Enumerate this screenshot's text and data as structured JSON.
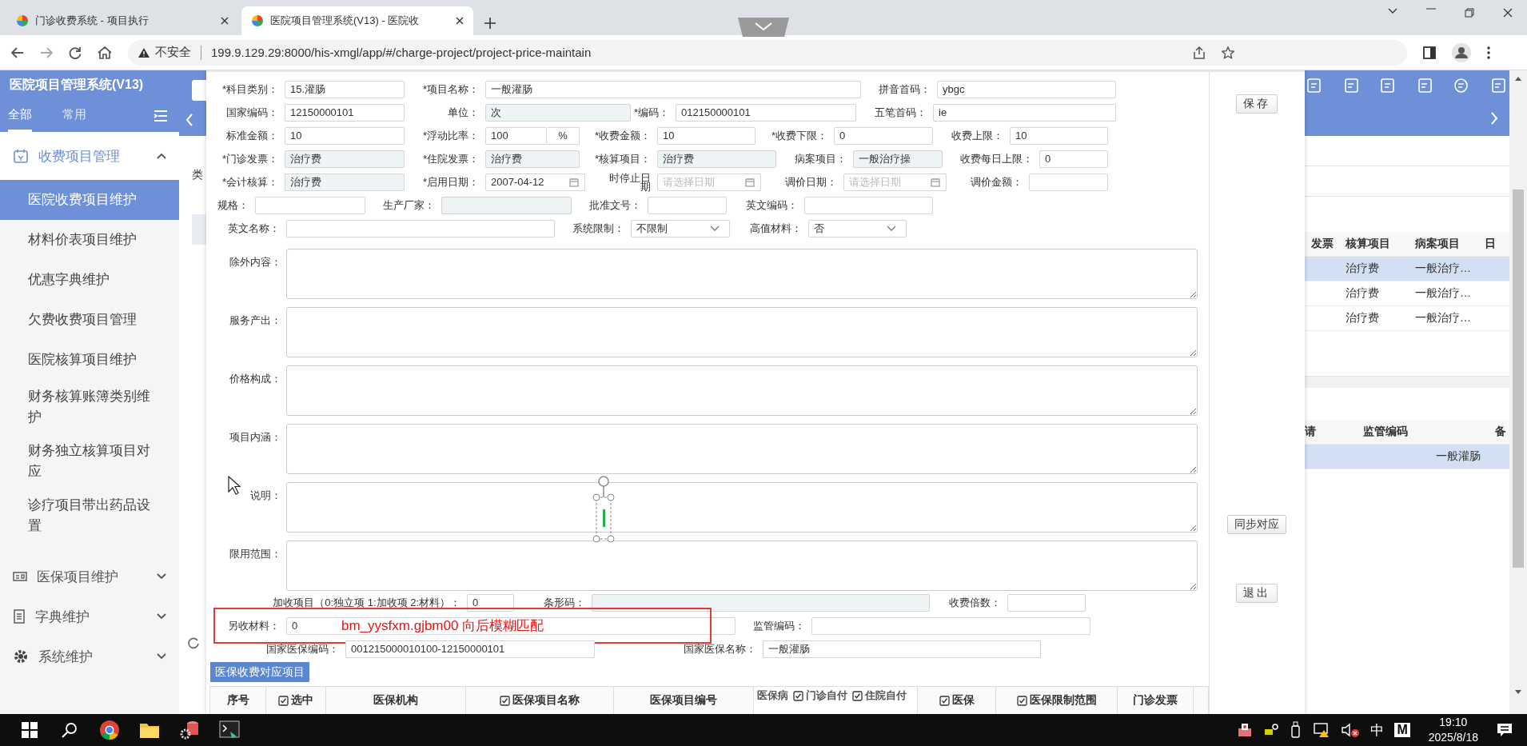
{
  "browser": {
    "tabs": [
      {
        "title": "门诊收费系统 - 项目执行",
        "selected": false
      },
      {
        "title": "医院项目管理系统(V13) - 医院收",
        "selected": true
      }
    ],
    "security": "不安全",
    "url": "199.9.129.29:8000/his-xmgl/app/#/charge-project/project-price-maintain"
  },
  "sidebar": {
    "title": "医院项目管理系统(V13)",
    "tabs": [
      {
        "label": "全部",
        "selected": true
      },
      {
        "label": "常用",
        "selected": false
      }
    ],
    "menu": [
      {
        "label": "收费项目管理",
        "expanded": true,
        "children": [
          {
            "label": "医院收费项目维护",
            "selected": true
          },
          {
            "label": "材料价表项目维护",
            "selected": false
          },
          {
            "label": "优惠字典维护",
            "selected": false
          },
          {
            "label": "欠费收费项目管理",
            "selected": false
          },
          {
            "label": "医院核算项目维护",
            "selected": false
          },
          {
            "label": "财务核算账簿类别维护",
            "selected": false
          },
          {
            "label": "财务独立核算项目对应",
            "selected": false
          },
          {
            "label": "诊疗项目带出药品设置",
            "selected": false
          }
        ]
      },
      {
        "label": "医保项目维护",
        "expanded": false
      },
      {
        "label": "字典维护",
        "expanded": false
      },
      {
        "label": "系统维护",
        "expanded": false
      }
    ]
  },
  "background": {
    "left_label": "类",
    "table1": {
      "columns": [
        "发票",
        "核算项目",
        "病案项目",
        "日"
      ],
      "rows": [
        {
          "cells": [
            "",
            "治疗费",
            "一般治疗…",
            ""
          ],
          "selected": true
        },
        {
          "cells": [
            "",
            "治疗费",
            "一般治疗…",
            ""
          ],
          "selected": false
        },
        {
          "cells": [
            "",
            "治疗费",
            "一般治疗…",
            ""
          ],
          "selected": false
        }
      ]
    },
    "table2": {
      "columns": [
        "请",
        "监管编码",
        "备"
      ],
      "rows": [
        {
          "cells": [
            "一般灌肠"
          ],
          "selected": true
        }
      ]
    }
  },
  "dialog": {
    "rows": [
      {
        "fields": [
          {
            "label": "*科目类别：",
            "kind": "text",
            "value": "15.灌肠",
            "readonly": false
          },
          {
            "label": "*项目名称：",
            "kind": "text",
            "value": "一般灌肠",
            "readonly": false
          },
          {
            "label": "拼音首码：",
            "kind": "text",
            "value": "ybgc",
            "readonly": false
          }
        ]
      },
      {
        "fields": [
          {
            "label": "国家编码：",
            "kind": "text",
            "value": "12150000101",
            "readonly": false
          },
          {
            "label": "单位：",
            "kind": "text",
            "value": "次",
            "readonly": true
          },
          {
            "label": "*编码：",
            "kind": "text",
            "value": "012150000101",
            "readonly": false
          },
          {
            "label": "五笔首码：",
            "kind": "text",
            "value": "ie",
            "readonly": false
          }
        ]
      },
      {
        "fields": [
          {
            "label": "标准金额：",
            "kind": "text",
            "value": "10",
            "readonly": false
          },
          {
            "label": "*浮动比率：",
            "kind": "percent",
            "value": "100",
            "unit": "%",
            "readonly": false
          },
          {
            "label": "*收费金额：",
            "kind": "text",
            "value": "10",
            "readonly": false
          },
          {
            "label": "*收费下限：",
            "kind": "text",
            "value": "0",
            "readonly": false
          },
          {
            "label": "收费上限：",
            "kind": "text",
            "value": "10",
            "readonly": false
          }
        ]
      },
      {
        "fields": [
          {
            "label": "*门诊发票：",
            "kind": "text",
            "value": "治疗费",
            "readonly": true
          },
          {
            "label": "*住院发票：",
            "kind": "text",
            "value": "治疗费",
            "readonly": true
          },
          {
            "label": "*核算项目：",
            "kind": "text",
            "value": "治疗费",
            "readonly": true
          },
          {
            "label": "病案项目：",
            "kind": "text",
            "value": "一般治疗操",
            "readonly": true
          },
          {
            "label": "收费每日上限：",
            "kind": "text",
            "value": "0",
            "readonly": false
          }
        ]
      },
      {
        "fields": [
          {
            "label": "*会计核算：",
            "kind": "text",
            "value": "治疗费",
            "readonly": true
          },
          {
            "label": "*启用日期：",
            "kind": "date",
            "value": "2007-04-12",
            "readonly": false
          },
          {
            "label": "时停止日期",
            "kind": "date",
            "placeholder": "请选择日期",
            "readonly": false
          },
          {
            "label": "调价日期：",
            "kind": "date",
            "placeholder": "请选择日期",
            "readonly": false
          },
          {
            "label": "调价金额：",
            "kind": "text",
            "readonly": false
          }
        ]
      },
      {
        "fields": [
          {
            "label": "规格：",
            "kind": "text",
            "readonly": false
          },
          {
            "label": "生产厂家：",
            "kind": "text",
            "readonly": true
          },
          {
            "label": "批准文号：",
            "kind": "text",
            "readonly": false
          },
          {
            "label": "英文编码：",
            "kind": "text",
            "readonly": false
          }
        ]
      },
      {
        "fields": [
          {
            "label": "英文名称：",
            "kind": "text",
            "readonly": false
          },
          {
            "label": "系统限制：",
            "kind": "select",
            "value": "不限制",
            "readonly": false
          },
          {
            "label": "高值材料：",
            "kind": "select",
            "value": "否",
            "readonly": false
          }
        ]
      }
    ],
    "textareas": [
      "除外内容：",
      "服务产出：",
      "价格构成：",
      "项目内涵：",
      "说明：",
      "限用范围："
    ],
    "extra_rows": [
      {
        "fields": [
          {
            "label": "加收项目（0:独立项 1:加收项 2:材料）：",
            "kind": "text",
            "value": "0",
            "readonly": false
          },
          {
            "label": "条形码：",
            "kind": "text",
            "readonly": true
          },
          {
            "label": "收费倍数：",
            "kind": "text",
            "readonly": false
          }
        ]
      },
      {
        "fields": [
          {
            "label": "另收材料：",
            "kind": "text",
            "value": "0",
            "readonly": false
          },
          {
            "label": "监管编码：",
            "kind": "text",
            "readonly": false
          }
        ],
        "annotation": "bm_yysfxm.gjbm00 向后模糊匹配"
      },
      {
        "fields": [
          {
            "label": "国家医保编码：",
            "kind": "text",
            "value": "001215000010100-12150000101",
            "readonly": false
          },
          {
            "label": "国家医保名称：",
            "kind": "text",
            "value": "一般灌肠",
            "readonly": false
          }
        ]
      }
    ],
    "buttons": [
      "保存",
      "同步对应",
      "退出"
    ],
    "tab": "医保收费对应项目",
    "columns": [
      {
        "label": "序号",
        "kind": "plain"
      },
      {
        "label": "选中",
        "kind": "checkbox",
        "checked": true
      },
      {
        "label": "医保机构",
        "kind": "plain"
      },
      {
        "label": "医保项目名称",
        "kind": "checkbox",
        "checked": true
      },
      {
        "label": "医保项目编号",
        "kind": "plain"
      },
      {
        "label": "医保病",
        "kind": "group",
        "children": [
          {
            "label": "门诊自付",
            "kind": "checkbox",
            "checked": true
          },
          {
            "label": "住院自付",
            "kind": "checkbox",
            "checked": true
          }
        ]
      },
      {
        "label": "医保",
        "kind": "checkbox",
        "checked": true
      },
      {
        "label": "医保限制范围",
        "kind": "checkbox",
        "checked": true
      },
      {
        "label": "门诊发票",
        "kind": "plain"
      }
    ]
  },
  "taskbar": {
    "ime": "中",
    "ime_mode": "M",
    "time": "19:10",
    "date": "2025/8/18"
  }
}
